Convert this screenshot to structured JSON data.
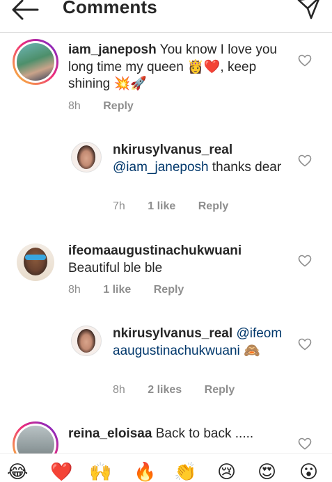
{
  "header": {
    "title": "Comments"
  },
  "comments": [
    {
      "username": "iam_janeposh",
      "text": "You know I love you long time my queen 👸❤️, keep shining 💥🚀",
      "time": "8h",
      "likes": "",
      "reply": "Reply"
    },
    {
      "username": "nkirusylvanus_real",
      "mention": "@iam_janeposh",
      "text": " thanks dear",
      "time": "7h",
      "likes": "1 like",
      "reply": "Reply"
    },
    {
      "username": "ifeomaaugustinachukwuani",
      "text": "Beautiful ble ble",
      "time": "8h",
      "likes": "1 like",
      "reply": "Reply"
    },
    {
      "username": "nkirusylvanus_real",
      "mention": "@ifeomaaugustinachukwuani",
      "text": " 🙈",
      "time": "8h",
      "likes": "2 likes",
      "reply": "Reply"
    },
    {
      "username": "reina_eloisaa",
      "text": "Back to back .....",
      "time": "",
      "likes": "",
      "reply": ""
    }
  ],
  "emoji_bar": [
    "😂",
    "❤️",
    "🙌",
    "🔥",
    "👏",
    "😢",
    "😍",
    "😮"
  ],
  "colors": {
    "mention": "#00376b",
    "meta": "#8e8e8e",
    "text": "#262626",
    "divider": "#dbdbdb"
  }
}
